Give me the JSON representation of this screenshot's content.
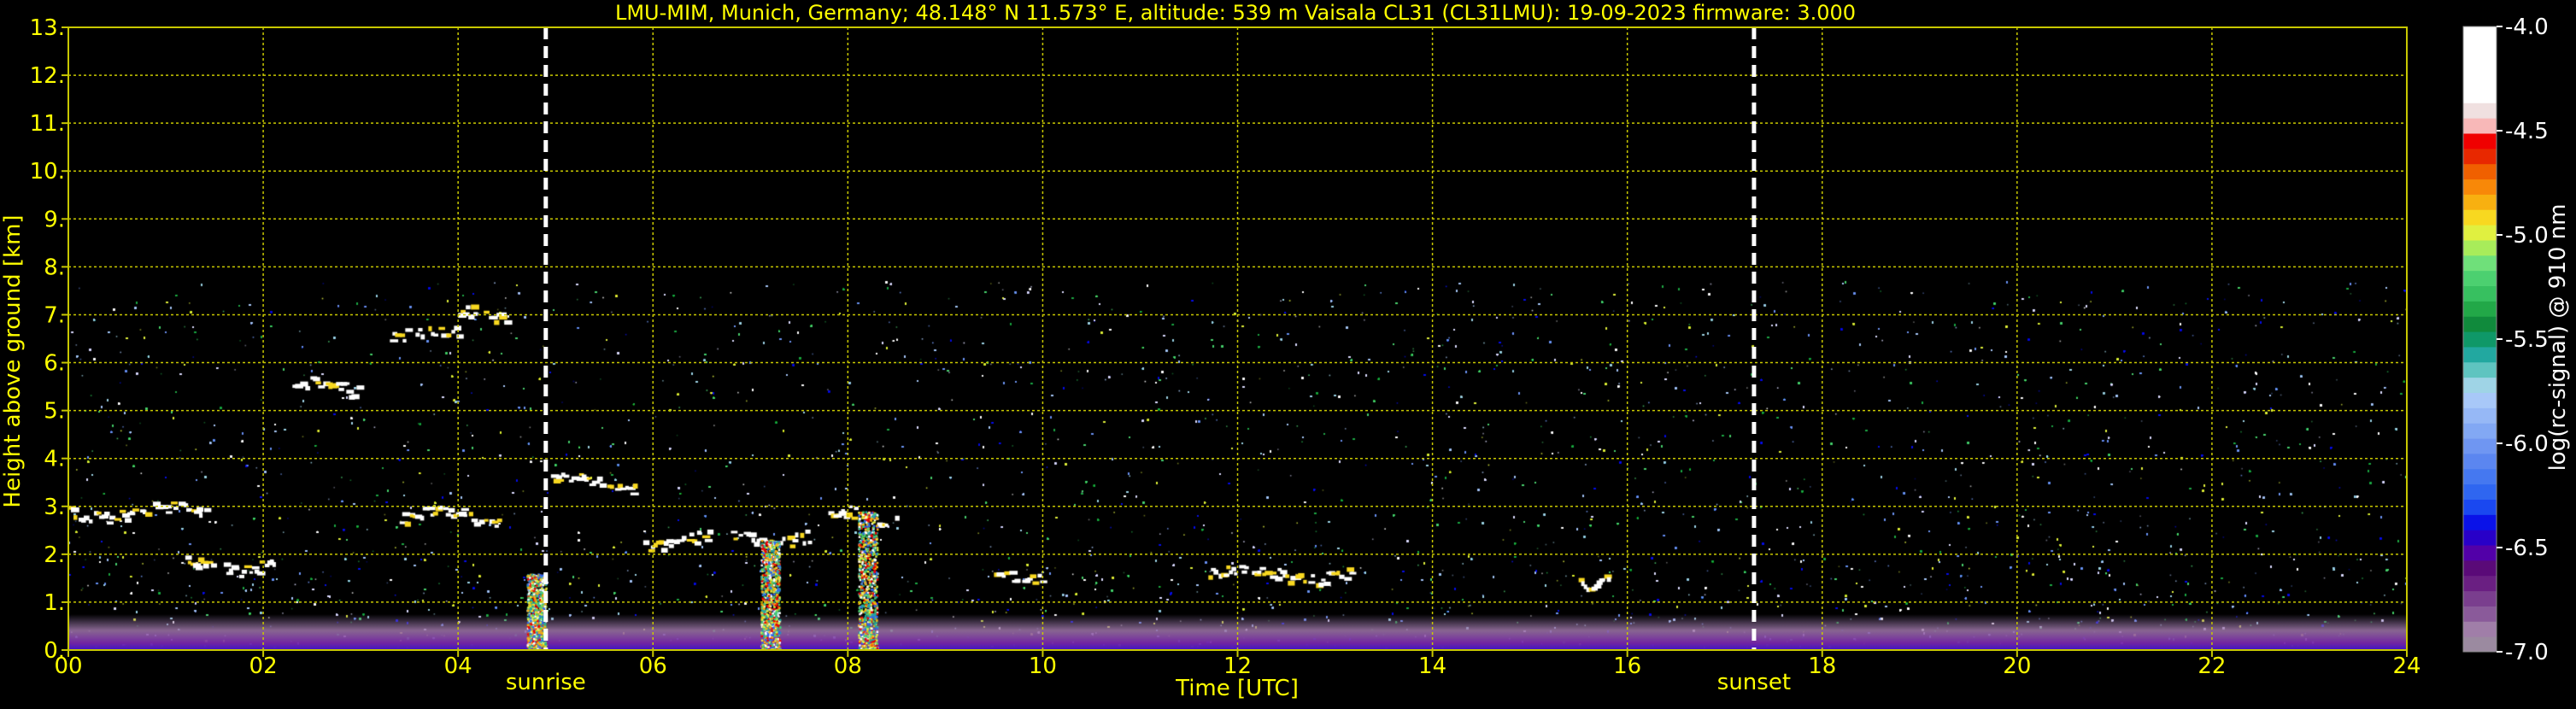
{
  "chart_data": {
    "type": "heatmap",
    "title": "LMU-MIM, Munich, Germany; 48.148° N 11.573° E, altitude: 539 m    Vaisala CL31 (CL31LMU): 19-09-2023    firmware: 3.000",
    "xlabel": "Time [UTC]",
    "ylabel": "Height above ground [km]",
    "x_ticks": [
      "00",
      "02",
      "04",
      "06",
      "08",
      "10",
      "12",
      "14",
      "16",
      "18",
      "20",
      "22",
      "24"
    ],
    "x_range": [
      0,
      24
    ],
    "y_ticks": [
      "0.",
      "1.",
      "2.",
      "3.",
      "4.",
      "5.",
      "6.",
      "7.",
      "8.",
      "9.",
      "10.",
      "11.",
      "12.",
      "13."
    ],
    "y_range": [
      0,
      13
    ],
    "grid": true,
    "colorbar": {
      "label": "log(rc-signal) @ 910 nm",
      "range": [
        -7.0,
        -4.0
      ],
      "ticks": [
        "-7.0",
        "-6.5",
        "-6.0",
        "-5.5",
        "-5.0",
        "-4.5",
        "-4.0"
      ],
      "colors": [
        "#9b8aa0",
        "#a07ea8",
        "#8a5a9a",
        "#7a3e8e",
        "#6a1f82",
        "#5a0a78",
        "#5200a8",
        "#2800c8",
        "#0a12e8",
        "#1a48f0",
        "#2f66f0",
        "#4578f0",
        "#5b86f0",
        "#6f96f2",
        "#82a8f4",
        "#96b8f6",
        "#a8c8f8",
        "#9fd4e6",
        "#5fc4c0",
        "#22a8a0",
        "#0f9868",
        "#108a3c",
        "#22a848",
        "#37c060",
        "#4cd070",
        "#6fe07a",
        "#a8ec5a",
        "#e0f040",
        "#f8d820",
        "#f8b010",
        "#f88808",
        "#f06000",
        "#e82800",
        "#f00000",
        "#f8b8b8",
        "#f0e0e0",
        "#ffffff",
        "#ffffff",
        "#ffffff",
        "#ffffff",
        "#ffffff"
      ]
    },
    "markers": [
      {
        "label": "sunrise",
        "x": 4.9
      },
      {
        "label": "sunset",
        "x": 17.3
      }
    ],
    "data_limit_km": 7.7,
    "cloud_layers": [
      {
        "x0": 0.0,
        "x1": 1.4,
        "y": 2.9
      },
      {
        "x0": 1.2,
        "x1": 2.1,
        "y": 1.8
      },
      {
        "x0": 2.3,
        "x1": 3.0,
        "y": 5.5
      },
      {
        "x0": 3.3,
        "x1": 4.0,
        "y": 6.6
      },
      {
        "x0": 3.4,
        "x1": 4.4,
        "y": 2.8
      },
      {
        "x0": 4.0,
        "x1": 4.5,
        "y": 7.1
      },
      {
        "x0": 4.9,
        "x1": 5.8,
        "y": 3.5
      },
      {
        "x0": 5.9,
        "x1": 6.6,
        "y": 2.3
      },
      {
        "x0": 6.8,
        "x1": 7.6,
        "y": 2.4
      },
      {
        "x0": 7.8,
        "x1": 8.5,
        "y": 2.8
      },
      {
        "x0": 9.5,
        "x1": 10.0,
        "y": 1.6
      },
      {
        "x0": 11.7,
        "x1": 13.2,
        "y": 1.6
      },
      {
        "x0": 15.5,
        "x1": 15.8,
        "y": 1.5
      }
    ],
    "aerosol_plumes": [
      {
        "x": 4.8,
        "y_top": 1.6
      },
      {
        "x": 7.2,
        "y_top": 2.3
      },
      {
        "x": 8.2,
        "y_top": 2.9
      }
    ],
    "boundary_layer_km": 0.5
  }
}
